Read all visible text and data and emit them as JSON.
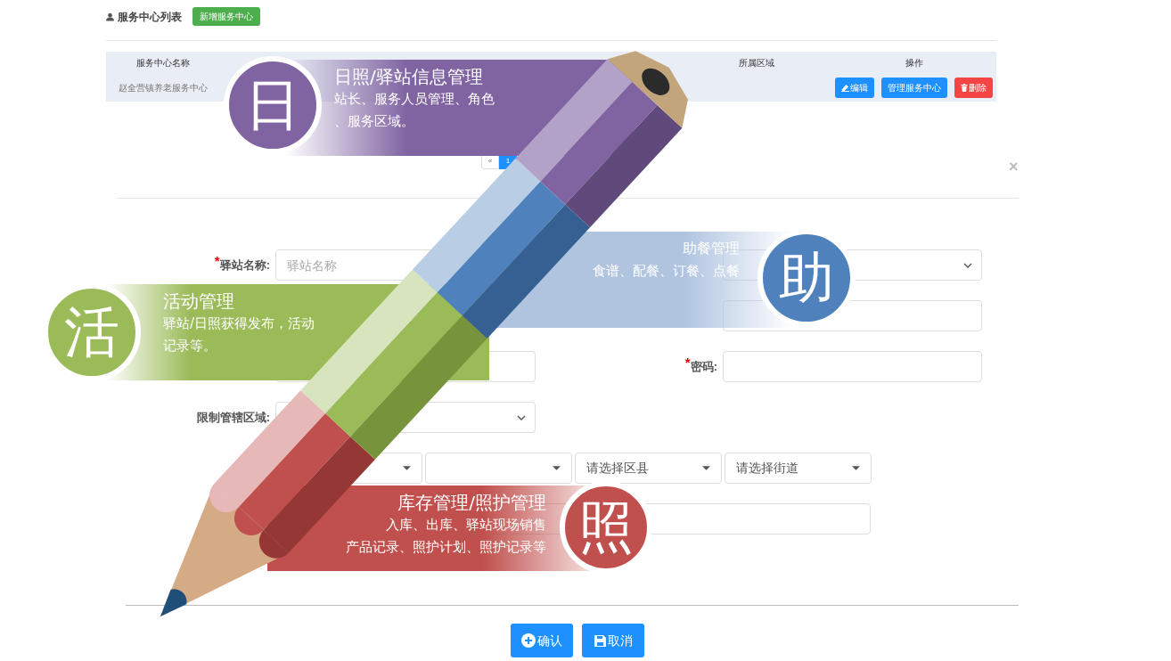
{
  "header": {
    "title": "服务中心列表",
    "add_button": "新增服务中心"
  },
  "table": {
    "columns": [
      "服务中心名称",
      "所属区域",
      "操作"
    ],
    "rows": [
      {
        "name": "赵全营镇养老服务中心",
        "actions": [
          {
            "label": "编辑",
            "kind": "edit"
          },
          {
            "label": "管理服务中心",
            "kind": "manage"
          },
          {
            "label": "删除",
            "kind": "delete"
          }
        ]
      }
    ]
  },
  "pagination": [
    {
      "label": "«",
      "selected": false
    },
    {
      "label": "1",
      "selected": true
    }
  ],
  "dialog": {
    "close": "×",
    "rows": [
      {
        "left": {
          "kind": "text",
          "label": "驿站名称:",
          "required_mark": "*",
          "placeholder": "驿站名称"
        },
        "right": {
          "kind": "select"
        }
      },
      {
        "right": {
          "kind": "text"
        }
      },
      {
        "left": {
          "kind": "text"
        },
        "right": {
          "kind": "password",
          "label": "密码:",
          "required_mark": "*"
        }
      },
      {
        "left": {
          "kind": "select",
          "label": "限制管辖区域:"
        }
      },
      {
        "left": {
          "kind": "address",
          "selects": [
            {
              "kind": "select"
            },
            {
              "kind": "select"
            },
            {
              "kind": "select",
              "placeholder": "请选择区县"
            },
            {
              "kind": "select",
              "placeholder": "请选择街道"
            }
          ]
        }
      },
      {
        "left": {
          "kind": "wide"
        }
      }
    ],
    "buttons": [
      {
        "label": "确认",
        "kind": "confirm"
      },
      {
        "label": "取消",
        "kind": "cancel"
      }
    ]
  },
  "features": [
    {
      "badge": "日",
      "title": "日照/驿站信息管理",
      "lines": [
        "站长、服务人员管理、角色",
        "、服务区域。"
      ],
      "color": "#8064a2"
    },
    {
      "badge": "助",
      "title": "助餐管理",
      "lines": [
        "食谱、配餐、订餐、点餐"
      ],
      "color": "#4f81bd"
    },
    {
      "badge": "活",
      "title": "活动管理",
      "lines": [
        "驿站/日照获得发布，活动",
        "记录等。"
      ],
      "color": "#9bbb59"
    },
    {
      "badge": "照",
      "title": "库存管理/照护管理",
      "lines": [
        "入库、出库、驿站现场销售",
        "产品记录、照护计划、照护记录等"
      ],
      "color": "#c0504d"
    }
  ]
}
